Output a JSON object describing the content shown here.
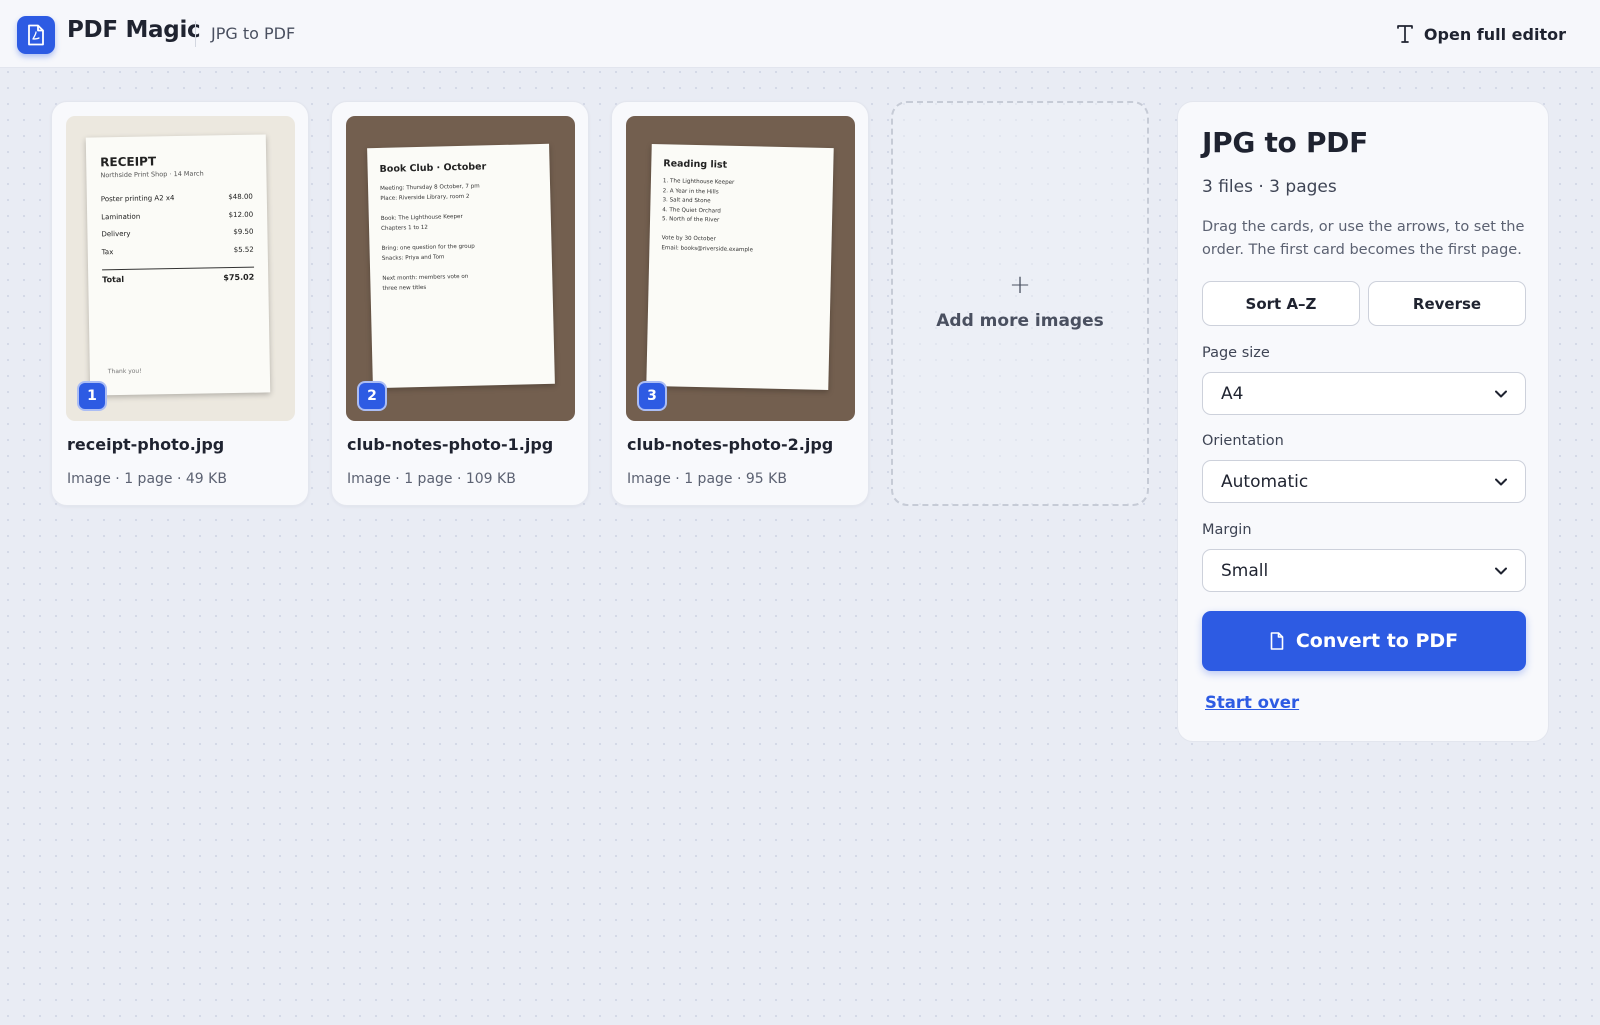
{
  "header": {
    "brand": "PDF Magic",
    "breadcrumb": "JPG to PDF",
    "editor_link": "Open full editor"
  },
  "files": [
    {
      "badge": "1",
      "name": "receipt-photo.jpg",
      "meta": "Image · 1 page · 49 KB",
      "photo": {
        "title": "RECEIPT",
        "subtitle": "Northside Print Shop · 14 March",
        "lines": [
          {
            "item": "Poster printing A2 x4",
            "amount": "$48.00"
          },
          {
            "item": "Lamination",
            "amount": "$12.00"
          },
          {
            "item": "Delivery",
            "amount": "$9.50"
          },
          {
            "item": "Tax",
            "amount": "$5.52"
          }
        ],
        "total_label": "Total",
        "total_amount": "$75.02",
        "footer": "Thank you!"
      }
    },
    {
      "badge": "2",
      "name": "club-notes-photo-1.jpg",
      "meta": "Image · 1 page · 109 KB",
      "photo": {
        "title": "Book Club · October",
        "lines": [
          "Meeting: Thursday 8 October, 7 pm",
          "Place: Riverside Library, room 2",
          "",
          "Book: The Lighthouse Keeper",
          "Chapters 1 to 12",
          "",
          "Bring: one question for the group",
          "Snacks: Priya and Tom",
          "",
          "Next month: members vote on",
          "three new titles"
        ]
      }
    },
    {
      "badge": "3",
      "name": "club-notes-photo-2.jpg",
      "meta": "Image · 1 page · 95 KB",
      "photo": {
        "title": "Reading list",
        "lines": [
          "1.  The Lighthouse Keeper",
          "2.  A Year in the Hills",
          "3.  Salt and Stone",
          "4.  The Quiet Orchard",
          "5.  North of the River",
          "",
          "Vote by 30 October",
          "Email: books@riverside.example"
        ]
      }
    }
  ],
  "add_more": {
    "icon": "plus-icon",
    "label": "Add more images"
  },
  "panel": {
    "title": "JPG to PDF",
    "count": "3 files · 3 pages",
    "help": "Drag the cards, or use the arrows, to set the order. The first card becomes the first page.",
    "sort_label": "Sort A–Z",
    "reverse_label": "Reverse",
    "page_size_label": "Page size",
    "page_size_value": "A4",
    "orientation_label": "Orientation",
    "orientation_value": "Automatic",
    "margin_label": "Margin",
    "margin_value": "Small",
    "convert_label": "Convert to PDF",
    "start_over_label": "Start over"
  },
  "colors": {
    "accent": "#2d5be3",
    "background": "#e9ecf4",
    "card": "#f8f9fc",
    "photo_dark_bg": "#735f4f"
  }
}
